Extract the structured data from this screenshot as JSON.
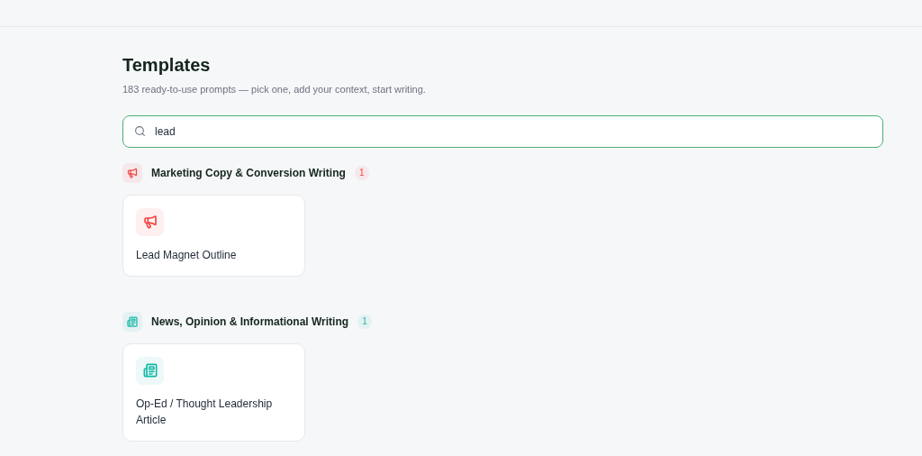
{
  "title": "Templates",
  "subtitle": "183 ready-to-use prompts — pick one, add your context, start writing.",
  "search": {
    "value": "lead"
  },
  "categories": [
    {
      "name": "Marketing Copy & Conversion Writing",
      "count": "1",
      "kind": "megaphone",
      "color": "#ef4444",
      "templates": [
        {
          "title": "Lead Magnet Outline"
        }
      ]
    },
    {
      "name": "News, Opinion & Informational Writing",
      "count": "1",
      "kind": "newspaper",
      "color": "#14b8a6",
      "templates": [
        {
          "title": "Op-Ed / Thought Leadership Article"
        }
      ]
    }
  ]
}
